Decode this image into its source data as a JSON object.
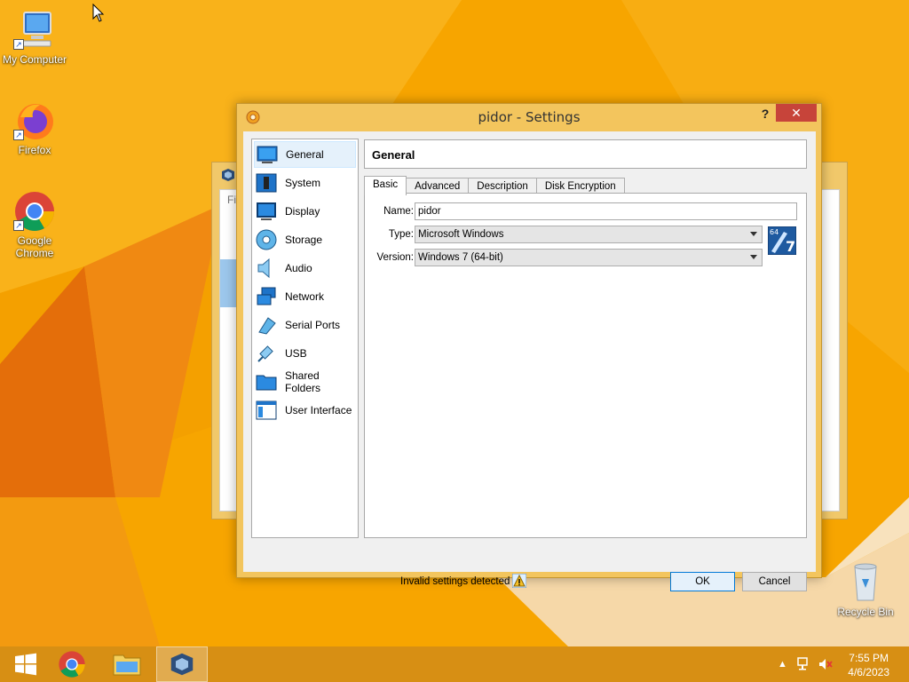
{
  "desktop": {
    "icons": [
      {
        "label": "My Computer",
        "icon": "computer-icon"
      },
      {
        "label": "Firefox",
        "icon": "firefox-icon"
      },
      {
        "label": "Google Chrome",
        "icon": "chrome-icon"
      },
      {
        "label": "Recycle Bin",
        "icon": "recycle-bin-icon"
      }
    ],
    "shortcut_glyph": "↗"
  },
  "background_window": {
    "partial_text": "Fi"
  },
  "dialog": {
    "title": "pidor - Settings",
    "help_label": "?",
    "close_label": "✕",
    "sidebar": [
      {
        "label": "General",
        "icon": "general-icon",
        "selected": true
      },
      {
        "label": "System",
        "icon": "chip-icon"
      },
      {
        "label": "Display",
        "icon": "monitor-icon"
      },
      {
        "label": "Storage",
        "icon": "disk-icon"
      },
      {
        "label": "Audio",
        "icon": "speaker-icon"
      },
      {
        "label": "Network",
        "icon": "network-icon"
      },
      {
        "label": "Serial Ports",
        "icon": "serial-port-icon"
      },
      {
        "label": "USB",
        "icon": "usb-icon"
      },
      {
        "label": "Shared Folders",
        "icon": "folder-icon"
      },
      {
        "label": "User Interface",
        "icon": "user-interface-icon"
      }
    ],
    "page_title": "General",
    "tabs": [
      {
        "label": "Basic",
        "active": true
      },
      {
        "label": "Advanced"
      },
      {
        "label": "Description"
      },
      {
        "label": "Disk Encryption"
      }
    ],
    "form": {
      "name_label": "Name:",
      "name_value": "pidor",
      "type_label": "Type:",
      "type_value": "Microsoft Windows",
      "version_label": "Version:",
      "version_value": "Windows 7 (64-bit)",
      "os_badge_bits": "64",
      "os_badge_version": "7"
    },
    "status_text": "Invalid settings detected",
    "ok_label": "OK",
    "cancel_label": "Cancel"
  },
  "taskbar": {
    "apps": [
      {
        "name": "start",
        "icon": "windows-start-icon"
      },
      {
        "name": "chrome",
        "icon": "chrome-icon"
      },
      {
        "name": "file-explorer",
        "icon": "folder-icon"
      },
      {
        "name": "virtualbox",
        "icon": "virtualbox-icon",
        "active": true
      }
    ],
    "time": "7:55 PM",
    "date": "4/6/2023",
    "tray_up_arrow": "▲"
  },
  "colors": {
    "wallpaper": "#f6a400",
    "dialog_frame": "#f3c55d",
    "close_button": "#c7443a",
    "selection": "#e5f1fb"
  }
}
